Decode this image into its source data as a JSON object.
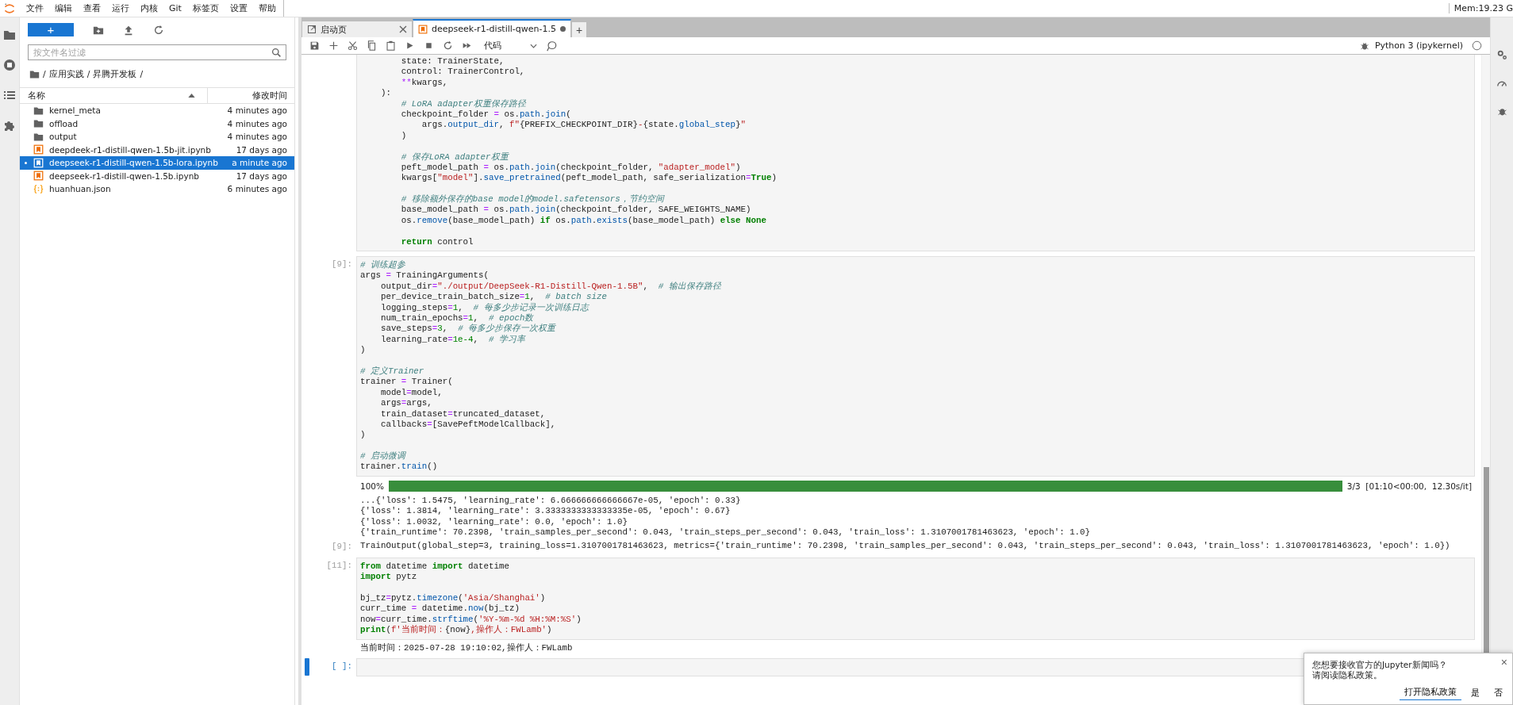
{
  "menu": [
    "文件",
    "编辑",
    "查看",
    "运行",
    "内核",
    "Git",
    "标签页",
    "设置",
    "帮助"
  ],
  "memory": "Mem:19.23 G",
  "file_browser": {
    "new_button": "+",
    "filter": {
      "placeholder": "按文件名过滤"
    },
    "breadcrumbs": [
      "/",
      "应用实践",
      "/",
      "昇腾开发板",
      "/"
    ],
    "columns": [
      {
        "label": "名称",
        "sorted": true
      },
      {
        "label": "修改时间",
        "sorted": false
      }
    ],
    "files": [
      {
        "name": "kernel_meta",
        "modified": "4 minutes ago",
        "kind": "folder",
        "selected": false,
        "running": false
      },
      {
        "name": "offload",
        "modified": "4 minutes ago",
        "kind": "folder",
        "selected": false,
        "running": false
      },
      {
        "name": "output",
        "modified": "4 minutes ago",
        "kind": "folder",
        "selected": false,
        "running": false
      },
      {
        "name": "deepdeek-r1-distill-qwen-1.5b-jit.ipynb",
        "modified": "17 days ago",
        "kind": "notebook",
        "selected": false,
        "running": false
      },
      {
        "name": "deepseek-r1-distill-qwen-1.5b-lora.ipynb",
        "modified": "a minute ago",
        "kind": "notebook",
        "selected": true,
        "running": true
      },
      {
        "name": "deepseek-r1-distill-qwen-1.5b.ipynb",
        "modified": "17 days ago",
        "kind": "notebook",
        "selected": false,
        "running": false
      },
      {
        "name": "huanhuan.json",
        "modified": "6 minutes ago",
        "kind": "json",
        "selected": false,
        "running": false
      }
    ]
  },
  "tabs": [
    {
      "label": "启动页",
      "kind": "launcher",
      "selected": false,
      "unsaved": false
    },
    {
      "label": "deepseek-r1-distill-qwen-1.5",
      "kind": "notebook",
      "selected": true,
      "unsaved": true
    }
  ],
  "add_tab": "+",
  "toolbar": {
    "cell_type": "代码",
    "kernel": "Python 3 (ipykernel)"
  },
  "cells": [
    {
      "active": false,
      "lines": [
        {
          "kind": "code",
          "tokens": [
            {
              "kind": "p",
              "text": "        state: TrainerState,"
            }
          ]
        },
        {
          "kind": "code",
          "tokens": [
            {
              "kind": "p",
              "text": "        control: TrainerControl,"
            }
          ]
        },
        {
          "kind": "code",
          "tokens": [
            {
              "kind": "op",
              "text": "        **"
            },
            {
              "kind": "p",
              "text": "kwargs,"
            }
          ]
        },
        {
          "kind": "code",
          "tokens": [
            {
              "kind": "p",
              "text": "    ):"
            }
          ]
        },
        {
          "kind": "code",
          "tokens": [
            {
              "kind": "cmt",
              "text": "        # LoRA adapter权重保存路径"
            }
          ]
        },
        {
          "kind": "code",
          "tokens": [
            {
              "kind": "p",
              "text": "        checkpoint_folder "
            },
            {
              "kind": "op",
              "text": "="
            },
            {
              "kind": "p",
              "text": " os."
            },
            {
              "kind": "attr",
              "text": "path"
            },
            {
              "kind": "p",
              "text": "."
            },
            {
              "kind": "attr",
              "text": "join"
            },
            {
              "kind": "p",
              "text": "("
            }
          ]
        },
        {
          "kind": "code",
          "tokens": [
            {
              "kind": "p",
              "text": "            args."
            },
            {
              "kind": "attr",
              "text": "output_dir"
            },
            {
              "kind": "p",
              "text": ", "
            },
            {
              "kind": "str",
              "text": "f\""
            },
            {
              "kind": "p",
              "text": "{PREFIX_CHECKPOINT_DIR}"
            },
            {
              "kind": "str",
              "text": "-"
            },
            {
              "kind": "p",
              "text": "{state."
            },
            {
              "kind": "attr",
              "text": "global_step"
            },
            {
              "kind": "p",
              "text": "}"
            },
            {
              "kind": "str",
              "text": "\""
            }
          ]
        },
        {
          "kind": "code",
          "tokens": [
            {
              "kind": "p",
              "text": "        )"
            }
          ]
        },
        {
          "kind": "blank"
        },
        {
          "kind": "code",
          "tokens": [
            {
              "kind": "cmt",
              "text": "        # 保存LoRA adapter权重"
            }
          ]
        },
        {
          "kind": "code",
          "tokens": [
            {
              "kind": "p",
              "text": "        peft_model_path "
            },
            {
              "kind": "op",
              "text": "="
            },
            {
              "kind": "p",
              "text": " os."
            },
            {
              "kind": "attr",
              "text": "path"
            },
            {
              "kind": "p",
              "text": "."
            },
            {
              "kind": "attr",
              "text": "join"
            },
            {
              "kind": "p",
              "text": "(checkpoint_folder, "
            },
            {
              "kind": "str",
              "text": "\"adapter_model\""
            },
            {
              "kind": "p",
              "text": ")"
            }
          ]
        },
        {
          "kind": "code",
          "tokens": [
            {
              "kind": "p",
              "text": "        kwargs["
            },
            {
              "kind": "str",
              "text": "\"model\""
            },
            {
              "kind": "p",
              "text": "]."
            },
            {
              "kind": "attr",
              "text": "save_pretrained"
            },
            {
              "kind": "p",
              "text": "(peft_model_path, safe_serialization"
            },
            {
              "kind": "op",
              "text": "="
            },
            {
              "kind": "kw",
              "text": "True"
            },
            {
              "kind": "p",
              "text": ")"
            }
          ]
        },
        {
          "kind": "blank"
        },
        {
          "kind": "code",
          "tokens": [
            {
              "kind": "cmt",
              "text": "        # 移除额外保存的base model的model.safetensors，节约空间"
            }
          ]
        },
        {
          "kind": "code",
          "tokens": [
            {
              "kind": "p",
              "text": "        base_model_path "
            },
            {
              "kind": "op",
              "text": "="
            },
            {
              "kind": "p",
              "text": " os."
            },
            {
              "kind": "attr",
              "text": "path"
            },
            {
              "kind": "p",
              "text": "."
            },
            {
              "kind": "attr",
              "text": "join"
            },
            {
              "kind": "p",
              "text": "(checkpoint_folder, SAFE_WEIGHTS_NAME)"
            }
          ]
        },
        {
          "kind": "code",
          "tokens": [
            {
              "kind": "p",
              "text": "        os."
            },
            {
              "kind": "attr",
              "text": "remove"
            },
            {
              "kind": "p",
              "text": "(base_model_path) "
            },
            {
              "kind": "kw",
              "text": "if"
            },
            {
              "kind": "p",
              "text": " os."
            },
            {
              "kind": "attr",
              "text": "path"
            },
            {
              "kind": "p",
              "text": "."
            },
            {
              "kind": "attr",
              "text": "exists"
            },
            {
              "kind": "p",
              "text": "(base_model_path) "
            },
            {
              "kind": "kw",
              "text": "else"
            },
            {
              "kind": "kw",
              "text": " None"
            }
          ]
        },
        {
          "kind": "blank"
        },
        {
          "kind": "code",
          "tokens": [
            {
              "kind": "kw",
              "text": "        return"
            },
            {
              "kind": "p",
              "text": " control"
            }
          ]
        }
      ]
    },
    {
      "prompt": "[9]:",
      "active": false,
      "lines": [
        {
          "kind": "code",
          "tokens": [
            {
              "kind": "cmt",
              "text": "# 训练超参"
            }
          ]
        },
        {
          "kind": "code",
          "tokens": [
            {
              "kind": "p",
              "text": "args "
            },
            {
              "kind": "op",
              "text": "="
            },
            {
              "kind": "p",
              "text": " TrainingArguments("
            }
          ]
        },
        {
          "kind": "code",
          "tokens": [
            {
              "kind": "p",
              "text": "    output_dir"
            },
            {
              "kind": "op",
              "text": "="
            },
            {
              "kind": "str",
              "text": "\"./output/DeepSeek-R1-Distill-Qwen-1.5B\""
            },
            {
              "kind": "p",
              "text": ",  "
            },
            {
              "kind": "cmt",
              "text": "# 输出保存路径"
            }
          ]
        },
        {
          "kind": "code",
          "tokens": [
            {
              "kind": "p",
              "text": "    per_device_train_batch_size"
            },
            {
              "kind": "op",
              "text": "="
            },
            {
              "kind": "num",
              "text": "1"
            },
            {
              "kind": "p",
              "text": ",  "
            },
            {
              "kind": "cmt",
              "text": "# batch size"
            }
          ]
        },
        {
          "kind": "code",
          "tokens": [
            {
              "kind": "p",
              "text": "    logging_steps"
            },
            {
              "kind": "op",
              "text": "="
            },
            {
              "kind": "num",
              "text": "1"
            },
            {
              "kind": "p",
              "text": ",  "
            },
            {
              "kind": "cmt",
              "text": "# 每多少步记录一次训练日志"
            }
          ]
        },
        {
          "kind": "code",
          "tokens": [
            {
              "kind": "p",
              "text": "    num_train_epochs"
            },
            {
              "kind": "op",
              "text": "="
            },
            {
              "kind": "num",
              "text": "1"
            },
            {
              "kind": "p",
              "text": ",  "
            },
            {
              "kind": "cmt",
              "text": "# epoch数"
            }
          ]
        },
        {
          "kind": "code",
          "tokens": [
            {
              "kind": "p",
              "text": "    save_steps"
            },
            {
              "kind": "op",
              "text": "="
            },
            {
              "kind": "num",
              "text": "3"
            },
            {
              "kind": "p",
              "text": ",  "
            },
            {
              "kind": "cmt",
              "text": "# 每多少步保存一次权重"
            }
          ]
        },
        {
          "kind": "code",
          "tokens": [
            {
              "kind": "p",
              "text": "    learning_rate"
            },
            {
              "kind": "op",
              "text": "="
            },
            {
              "kind": "num",
              "text": "1e-4"
            },
            {
              "kind": "p",
              "text": ",  "
            },
            {
              "kind": "cmt",
              "text": "# 学习率"
            }
          ]
        },
        {
          "kind": "code",
          "tokens": [
            {
              "kind": "p",
              "text": ")"
            }
          ]
        },
        {
          "kind": "blank"
        },
        {
          "kind": "code",
          "tokens": [
            {
              "kind": "cmt",
              "text": "# 定义Trainer"
            }
          ]
        },
        {
          "kind": "code",
          "tokens": [
            {
              "kind": "p",
              "text": "trainer "
            },
            {
              "kind": "op",
              "text": "="
            },
            {
              "kind": "p",
              "text": " Trainer("
            }
          ]
        },
        {
          "kind": "code",
          "tokens": [
            {
              "kind": "p",
              "text": "    model"
            },
            {
              "kind": "op",
              "text": "="
            },
            {
              "kind": "p",
              "text": "model,"
            }
          ]
        },
        {
          "kind": "code",
          "tokens": [
            {
              "kind": "p",
              "text": "    args"
            },
            {
              "kind": "op",
              "text": "="
            },
            {
              "kind": "p",
              "text": "args,"
            }
          ]
        },
        {
          "kind": "code",
          "tokens": [
            {
              "kind": "p",
              "text": "    train_dataset"
            },
            {
              "kind": "op",
              "text": "="
            },
            {
              "kind": "p",
              "text": "truncated_dataset,"
            }
          ]
        },
        {
          "kind": "code",
          "tokens": [
            {
              "kind": "p",
              "text": "    callbacks"
            },
            {
              "kind": "op",
              "text": "="
            },
            {
              "kind": "p",
              "text": "[SavePeftModelCallback],"
            }
          ]
        },
        {
          "kind": "code",
          "tokens": [
            {
              "kind": "p",
              "text": ")"
            }
          ]
        },
        {
          "kind": "blank"
        },
        {
          "kind": "code",
          "tokens": [
            {
              "kind": "cmt",
              "text": "# 启动微调"
            }
          ]
        },
        {
          "kind": "code",
          "tokens": [
            {
              "kind": "p",
              "text": "trainer."
            },
            {
              "kind": "attr",
              "text": "train"
            },
            {
              "kind": "p",
              "text": "()"
            }
          ]
        }
      ],
      "outputs": [
        {
          "kind": "progress",
          "label": "100%",
          "level": 1,
          "reading": "3/3  [01:10<00:00,  12.30s/it]"
        },
        {
          "kind": "stream",
          "lines": [
            "...{'loss': 1.5475, 'learning_rate': 6.666666666666667e-05, 'epoch': 0.33}",
            "{'loss': 1.3814, 'learning_rate': 3.3333333333333335e-05, 'epoch': 0.67}",
            "{'loss': 1.0032, 'learning_rate': 0.0, 'epoch': 1.0}",
            "{'train_runtime': 70.2398, 'train_samples_per_second': 0.043, 'train_steps_per_second': 0.043, 'train_loss': 1.3107001781463623, 'epoch': 1.0}"
          ]
        },
        {
          "kind": "stream",
          "prompt": "[9]:",
          "lines": [
            "TrainOutput(global_step=3, training_loss=1.3107001781463623, metrics={'train_runtime': 70.2398, 'train_samples_per_second': 0.043, 'train_steps_per_second': 0.043, 'train_loss': 1.3107001781463623, 'epoch': 1.0})"
          ]
        }
      ]
    },
    {
      "prompt": "[11]:",
      "active": false,
      "lines": [
        {
          "kind": "code",
          "tokens": [
            {
              "kind": "kw",
              "text": "from"
            },
            {
              "kind": "p",
              "text": " datetime "
            },
            {
              "kind": "kw",
              "text": "import"
            },
            {
              "kind": "p",
              "text": " datetime"
            }
          ]
        },
        {
          "kind": "code",
          "tokens": [
            {
              "kind": "kw",
              "text": "import"
            },
            {
              "kind": "p",
              "text": " pytz"
            }
          ]
        },
        {
          "kind": "blank"
        },
        {
          "kind": "code",
          "tokens": [
            {
              "kind": "p",
              "text": "bj_tz"
            },
            {
              "kind": "op",
              "text": "="
            },
            {
              "kind": "p",
              "text": "pytz."
            },
            {
              "kind": "attr",
              "text": "timezone"
            },
            {
              "kind": "p",
              "text": "("
            },
            {
              "kind": "str",
              "text": "'Asia/Shanghai'"
            },
            {
              "kind": "p",
              "text": ")"
            }
          ]
        },
        {
          "kind": "code",
          "tokens": [
            {
              "kind": "p",
              "text": "curr_time "
            },
            {
              "kind": "op",
              "text": "="
            },
            {
              "kind": "p",
              "text": " datetime."
            },
            {
              "kind": "attr",
              "text": "now"
            },
            {
              "kind": "p",
              "text": "(bj_tz)"
            }
          ]
        },
        {
          "kind": "code",
          "tokens": [
            {
              "kind": "p",
              "text": "now"
            },
            {
              "kind": "op",
              "text": "="
            },
            {
              "kind": "p",
              "text": "curr_time."
            },
            {
              "kind": "attr",
              "text": "strftime"
            },
            {
              "kind": "p",
              "text": "("
            },
            {
              "kind": "str",
              "text": "'%Y-%m-%d %H:%M:%S'"
            },
            {
              "kind": "p",
              "text": ")"
            }
          ]
        },
        {
          "kind": "code",
          "tokens": [
            {
              "kind": "kw",
              "text": "print"
            },
            {
              "kind": "p",
              "text": "("
            },
            {
              "kind": "str",
              "text": "f'当前时间："
            },
            {
              "kind": "p",
              "text": "{now}"
            },
            {
              "kind": "str",
              "text": ",操作人：FWLamb'"
            },
            {
              "kind": "p",
              "text": ")"
            }
          ]
        }
      ],
      "outputs": [
        {
          "kind": "stream",
          "lines": [
            "当前时间：2025-07-28 19:10:02,操作人：FWLamb"
          ]
        }
      ]
    },
    {
      "prompt": "[ ]:",
      "active": true
    }
  ],
  "notification": {
    "lines": [
      "您想要接收官方的Jupyter新闻吗？",
      "请阅读隐私政策。"
    ],
    "link": "打开隐私政策",
    "buttons": [
      "是",
      "否"
    ],
    "close": "×"
  }
}
